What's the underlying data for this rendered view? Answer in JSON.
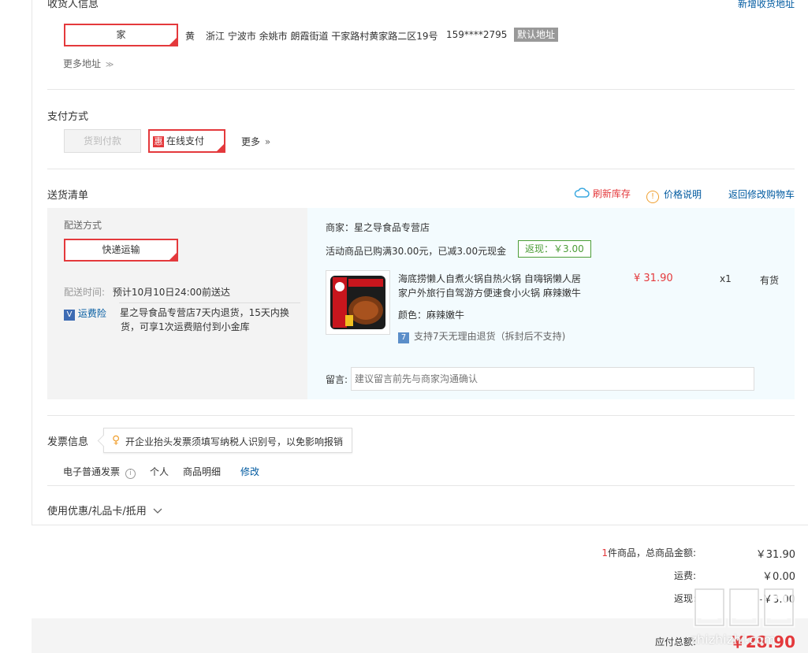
{
  "consignee": {
    "title": "收货人信息",
    "add_link": "新增收货地址",
    "selected_tag": "家",
    "name": "黄",
    "address": "浙江 宁波市 余姚市 朗霞街道 干家路村黄家路二区19号",
    "phone": "159****2795",
    "default_badge": "默认地址",
    "more_addresses": "更多地址",
    "more_icon": "chevron-double-down-icon"
  },
  "payment": {
    "title": "支付方式",
    "cod_label": "货到付款",
    "online_badge": "惠",
    "online_label": "在线支付",
    "more_label": "更多",
    "more_icon": "chevron-double-right-icon"
  },
  "delivery": {
    "title": "送货清单",
    "refresh_label": "刷新库存",
    "price_note_label": "价格说明",
    "back_to_cart": "返回修改购物车",
    "method_label": "配送方式",
    "method_value": "快递运输",
    "time_label": "配送时间:",
    "time_value": "预计10月10日24:00前送达",
    "insurance_badge": "V",
    "insurance_label": "运费险",
    "insurance_line1": "星之导食品专营店7天内退货，15天内换",
    "insurance_line2": "货，可享1次运费赔付到小金库",
    "merchant": "商家：星之导食品专营店",
    "promo_text": "活动商品已购满30.00元，已减3.00元现金",
    "promo_badge": "返现：￥3.00",
    "product_name_line1": "海底捞懒人自煮火锅自热火锅 自嗨锅懒人居",
    "product_name_line2": "家户外旅行自驾游方便速食小火锅 麻辣嫩牛",
    "product_color": "颜色：麻辣嫩牛",
    "product_return": "支持7天无理由退货（拆封后不支持)",
    "product_price": "¥ 31.90",
    "product_qty": "x1",
    "product_stock": "有货",
    "message_label": "留言:",
    "message_placeholder": "建议留言前先与商家沟通确认"
  },
  "invoice": {
    "title": "发票信息",
    "tip": "开企业抬头发票须填写纳税人识别号，以免影响报销",
    "type": "电子普通发票",
    "person": "个人",
    "detail": "商品明细",
    "edit": "修改"
  },
  "coupons": {
    "label": "使用优惠/礼品卡/抵用"
  },
  "summary": {
    "count": "1",
    "count_suffix": "件商品，总商品金额:",
    "total": "￥31.90",
    "shipping_label": "运费:",
    "shipping": "￥0.00",
    "cashback_label": "返现:",
    "cashback": "-￥3.00",
    "payable_label": "应付总额:",
    "payable": "￥28.90"
  },
  "watermark": {
    "text": "zhizhizhi.com"
  },
  "colors": {
    "accent": "#e4393c",
    "link": "#005aa0",
    "promo": "#4c9d37"
  }
}
